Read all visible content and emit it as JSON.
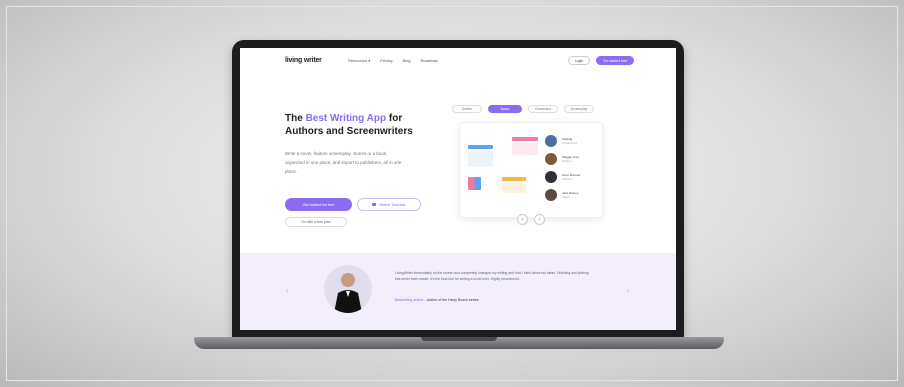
{
  "nav": {
    "logo": "living writer",
    "links": [
      "Resources ▾",
      "Pricing",
      "Blog",
      "Roadmap"
    ],
    "login": "Login",
    "cta": "Get started free"
  },
  "hero": {
    "title_prefix": "The ",
    "title_accent": "Best Writing App",
    "title_suffix": " for Authors and Screenwriters",
    "description": "Write a novel, feature screenplay, stories or a book, organized in one place, and export to publishers, all in one place.",
    "primary_button": "Get started for free",
    "secondary_button": "Watch Tutorials",
    "tertiary_button": "Go with a free plan"
  },
  "preview": {
    "tabs": [
      "Outline",
      "Board",
      "Characters",
      "Screenplay"
    ],
    "active_tab": 1,
    "characters": [
      {
        "name": "Sterling",
        "role": "Protagonist",
        "color": "#4a6fa5"
      },
      {
        "name": "Maggie Grey",
        "role": "Partner",
        "color": "#7b5a3c"
      },
      {
        "name": "Anne Ronnan",
        "role": "Partner",
        "color": "#2f2f35"
      },
      {
        "name": "Jack Raines",
        "role": "Villain",
        "color": "#5b4b42"
      }
    ],
    "prev_arrow": "‹",
    "next_arrow": "›"
  },
  "testimonial": {
    "quote": "LivingWriter immediately on the screen and completely changed my writing and how I think about my ideas. Outlining and plotting has never been easier. It's the best tool for writing a novel ever. Highly recommend.",
    "author_role": "Bestselling author",
    "author_name": " - Author of the Harry Bosch series",
    "left_arrow": "‹",
    "right_arrow": "›"
  },
  "colors": {
    "accent": "#8b6cf0",
    "testimonial_bg": "#f3eefb",
    "bezel": "#1d1d1f"
  }
}
